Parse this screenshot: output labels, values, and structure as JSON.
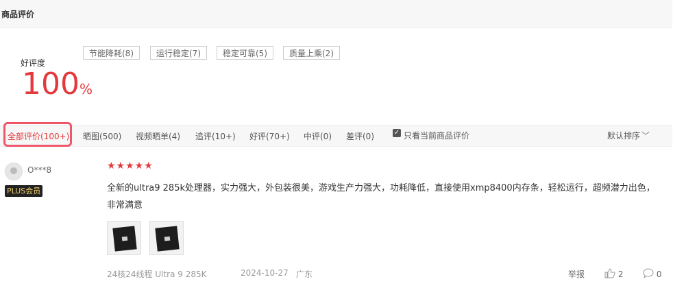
{
  "header": {
    "title": "商品评价"
  },
  "rating": {
    "label": "好评度",
    "value": "100",
    "unit": "%"
  },
  "tags": [
    "节能降耗(8)",
    "运行稳定(7)",
    "稳定可靠(5)",
    "质量上乘(2)"
  ],
  "filters": [
    "全部评价(100+)",
    "晒图(500)",
    "视频晒单(4)",
    "追评(10+)",
    "好评(70+)",
    "中评(0)",
    "差评(0)"
  ],
  "only_current": {
    "label": "只看当前商品评价",
    "checked": true
  },
  "sort": {
    "label": "默认排序"
  },
  "review": {
    "user": "O***8",
    "badge": "PLUS会员",
    "stars": 5,
    "stars_text": "★★★★★",
    "text": "全新的ultra9 285k处理器，实力强大，外包装很美，游戏生产力强大，功耗降低，直接使用xmp8400内存条，轻松运行，超频潜力出色，非常满意",
    "product": "24核24线程 Ultra 9 285K",
    "date": "2024-10-27",
    "location": "广东",
    "report": "举报",
    "likes": "2",
    "comments": "0"
  },
  "icons": [
    "avatar-icon",
    "checkbox-icon",
    "chevron-down-icon",
    "thumbs-up-icon",
    "comment-icon"
  ]
}
